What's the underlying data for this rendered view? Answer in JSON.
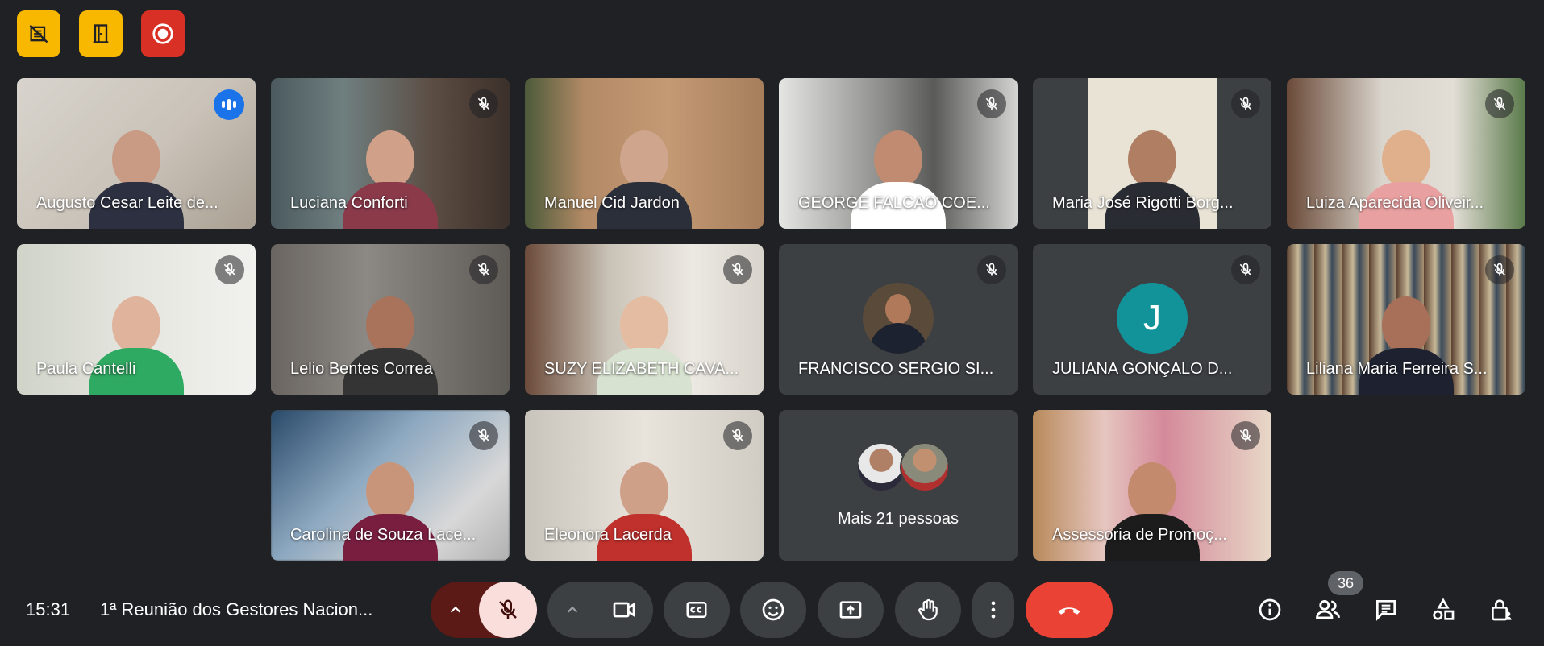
{
  "top_badges": [
    {
      "icon": "no-ads-icon",
      "color": "#f9b800"
    },
    {
      "icon": "door-icon",
      "color": "#f9b800"
    },
    {
      "icon": "record-icon",
      "color": "#d93025"
    }
  ],
  "participants": [
    {
      "name": "Augusto Cesar Leite de...",
      "status": "speaking"
    },
    {
      "name": "Luciana Conforti",
      "status": "muted"
    },
    {
      "name": "Manuel Cid Jardon",
      "status": "none"
    },
    {
      "name": "GEORGE FALCAO COE...",
      "status": "muted"
    },
    {
      "name": "Maria José Rigotti Borg...",
      "status": "muted"
    },
    {
      "name": "Luiza Aparecida Oliveir...",
      "status": "muted"
    },
    {
      "name": "Paula Cantelli",
      "status": "muted"
    },
    {
      "name": "Lelio Bentes Correa",
      "status": "muted"
    },
    {
      "name": "SUZY ELIZABETH CAVA...",
      "status": "muted"
    },
    {
      "name": "FRANCISCO SERGIO SI...",
      "status": "muted"
    },
    {
      "name": "JULIANA GONÇALO D...",
      "status": "muted",
      "initial": "J"
    },
    {
      "name": "Liliana Maria Ferreira S...",
      "status": "muted"
    },
    {
      "name": "Carolina de Souza Lace...",
      "status": "muted"
    },
    {
      "name": "Eleonora Lacerda",
      "status": "muted"
    },
    {
      "name": "Assessoria de Promoç...",
      "status": "muted"
    }
  ],
  "more_people": {
    "label": "Mais 21 pessoas"
  },
  "bottom_bar": {
    "time": "15:31",
    "meeting_title": "1ª Reunião dos Gestores Nacion...",
    "participant_count": "36"
  },
  "colors": {
    "background": "#202124",
    "tile": "#3c4043",
    "active_outline": "#8ab4f8",
    "end_call": "#ea4335",
    "mic_off": "#f9dedc"
  }
}
